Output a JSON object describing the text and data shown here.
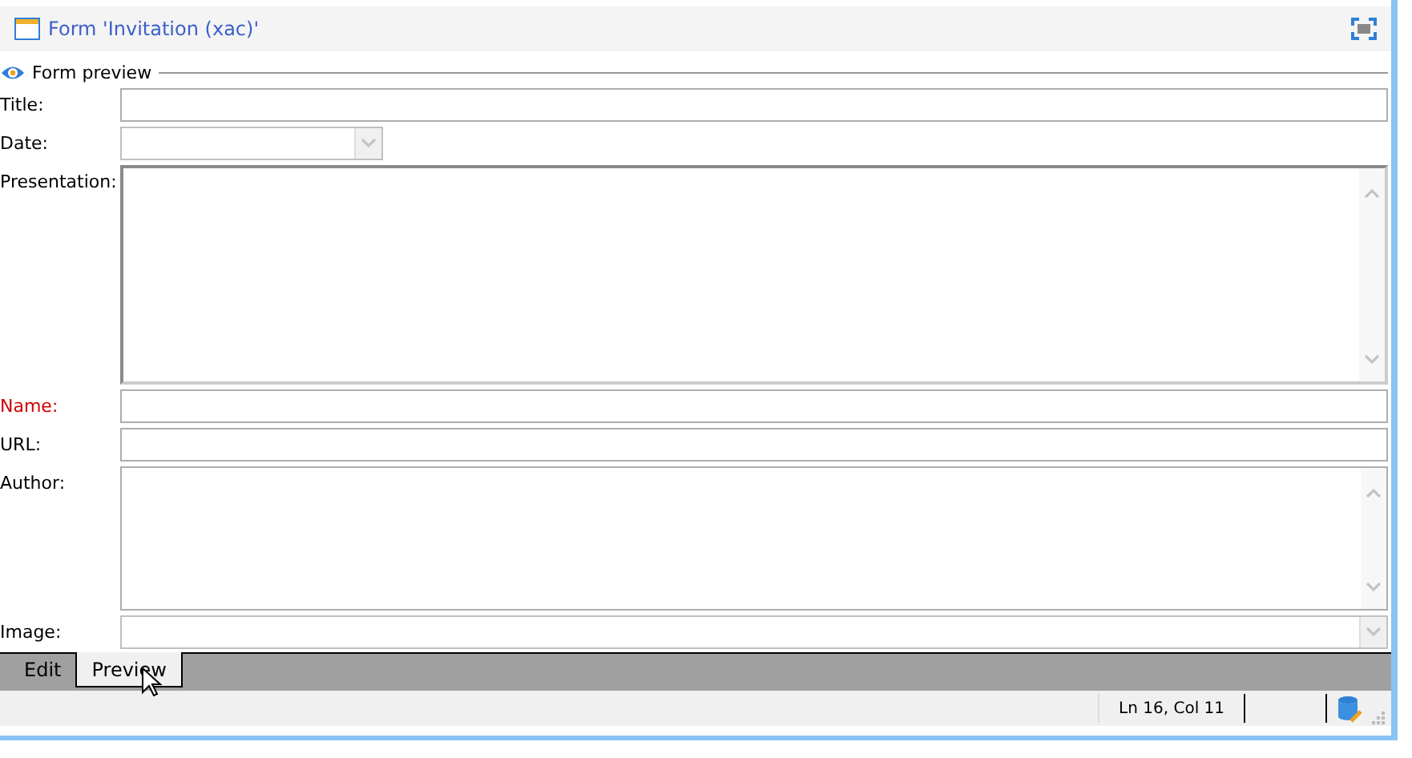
{
  "window": {
    "title": "Form 'Invitation (xac)'"
  },
  "group": {
    "title": "Form preview"
  },
  "fields": [
    {
      "label": "Title:",
      "kind": "text",
      "required": false
    },
    {
      "label": "Date:",
      "kind": "date",
      "required": false
    },
    {
      "label": "Presentation:",
      "kind": "memo",
      "required": false
    },
    {
      "label": "Name:",
      "kind": "text",
      "required": true
    },
    {
      "label": "URL:",
      "kind": "text",
      "required": false
    },
    {
      "label": "Author:",
      "kind": "memo-small",
      "required": false
    },
    {
      "label": "Image:",
      "kind": "combo",
      "required": false
    }
  ],
  "tabs": [
    {
      "label": "Edit",
      "selected": false
    },
    {
      "label": "Preview",
      "selected": true
    }
  ],
  "status_bar": {
    "position": "Ln 16, Col 11"
  }
}
